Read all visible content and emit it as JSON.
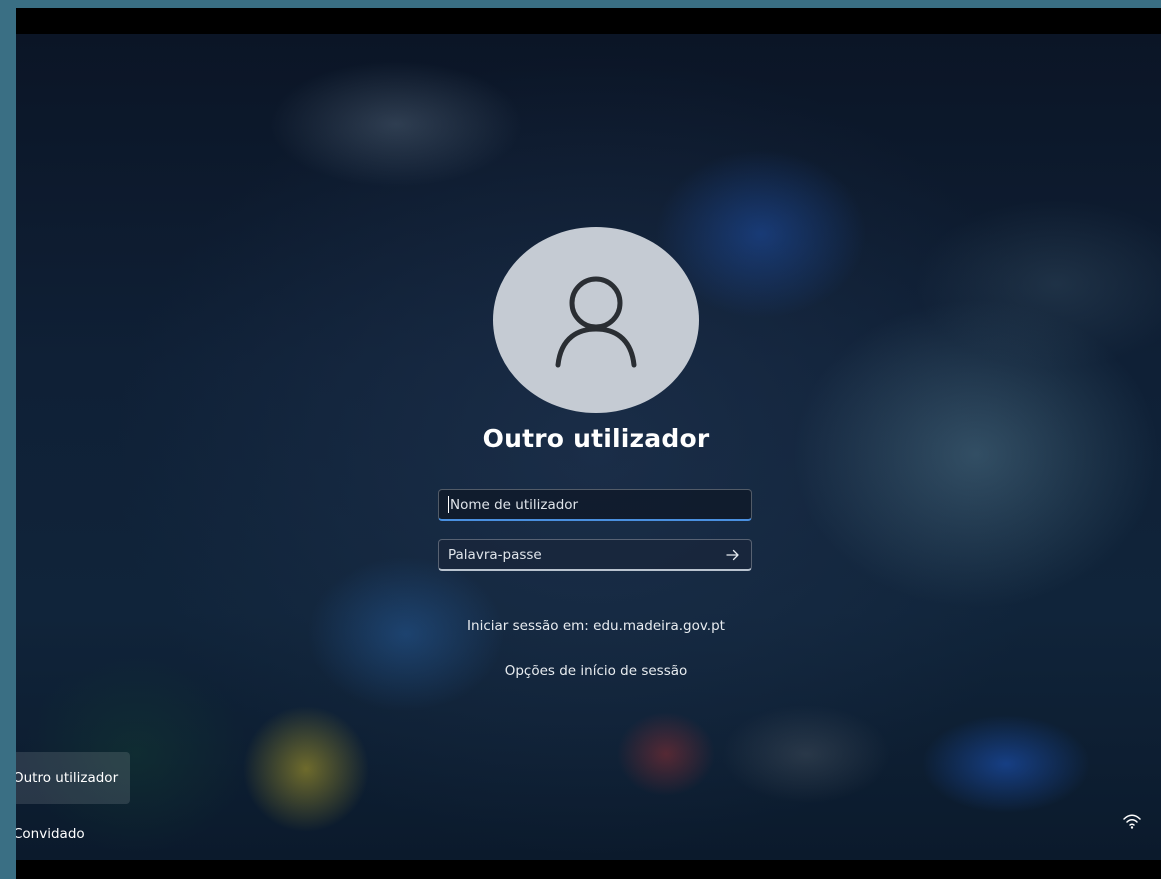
{
  "login": {
    "user_name": "Outro utilizador",
    "username_placeholder": "Nome de utilizador",
    "password_placeholder": "Palavra-passe",
    "signin_domain": "Iniciar sessão em: edu.madeira.gov.pt",
    "signin_options": "Opções de início de sessão"
  },
  "users": {
    "items": [
      {
        "label": "Outro utilizador",
        "selected": true
      },
      {
        "label": "Convidado",
        "selected": false
      }
    ]
  },
  "icons": {
    "avatar": "person-icon",
    "submit": "arrow-right-icon",
    "network": "wifi-icon"
  },
  "colors": {
    "accent": "#4a90e0",
    "avatar_bg": "#c5cbd3"
  }
}
